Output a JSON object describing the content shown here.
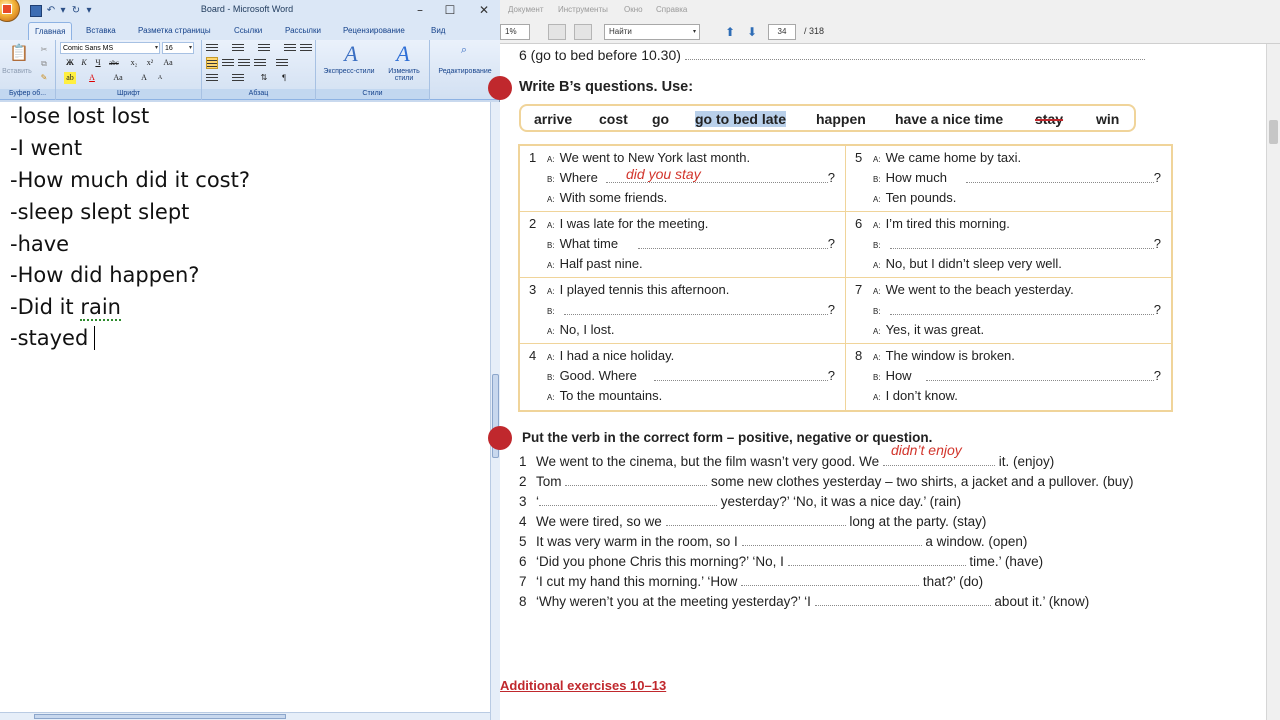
{
  "word": {
    "window_title": "Board - Microsoft Word",
    "tabs": [
      "Главная",
      "Вставка",
      "Разметка страницы",
      "Ссылки",
      "Рассылки",
      "Рецензирование",
      "Вид"
    ],
    "ribbon": {
      "paste_label": "Вставить",
      "clipboard_label": "Буфер об...",
      "font_name": "Comic Sans MS",
      "font_size": "16",
      "font_group_label": "Шрифт",
      "paragraph_group_label": "Абзац",
      "styles_label": "Экспресс-стили",
      "change_styles_label": "Изменить стили",
      "styles_group_label": "Стили",
      "editing_label": "Редактирование"
    },
    "doc_lines": [
      "-lose lost lost",
      "-I went",
      "-How much did it cost?",
      "-sleep slept slept",
      "-have",
      "-How did happen?",
      "-Did it ",
      "rain",
      "-stayed"
    ]
  },
  "pdf": {
    "menu": [
      "Документ",
      "Инструменты",
      "Окно",
      "Справка"
    ],
    "zoom_value": "1%",
    "search_placeholder": "Найти",
    "current_page": "34",
    "total_pages": "/ 318",
    "prev_line": "6   (go to bed before 10.30)",
    "section1_title": "Write B’s questions.  Use:",
    "word_bank": [
      "arrive",
      "cost",
      "go",
      "go to bed late",
      "happen",
      "have a nice time",
      "stay",
      "win"
    ],
    "dialogues": [
      {
        "num": "1",
        "a1": "We went to New York last month.",
        "b": "Where",
        "b_answer": "did you stay",
        "a2": "With some friends."
      },
      {
        "num": "2",
        "a1": "I was late for the meeting.",
        "b": "What time",
        "b_answer": "",
        "a2": "Half past nine."
      },
      {
        "num": "3",
        "a1": "I played tennis this afternoon.",
        "b": "",
        "b_answer": "",
        "a2": "No, I lost."
      },
      {
        "num": "4",
        "a1": "I had a nice holiday.",
        "b": "Good.  Where",
        "b_answer": "",
        "a2": "To the mountains."
      },
      {
        "num": "5",
        "a1": "We came home by taxi.",
        "b": "How much",
        "b_answer": "",
        "a2": "Ten pounds."
      },
      {
        "num": "6",
        "a1": "I’m tired this morning.",
        "b": "",
        "b_answer": "",
        "a2": "No, but I didn’t sleep very well."
      },
      {
        "num": "7",
        "a1": "We went to the beach yesterday.",
        "b": "",
        "b_answer": "",
        "a2": "Yes, it was great."
      },
      {
        "num": "8",
        "a1": "The window is broken.",
        "b": "How",
        "b_answer": "",
        "a2": "I don’t know."
      }
    ],
    "speaker_a": "A:",
    "speaker_b": "B:",
    "q_mark": "?",
    "section2_title": "Put the verb in the correct form – positive, negative or question.",
    "exercises": [
      {
        "n": "1",
        "pre": "We went to the cinema, but the film wasn’t very good.  We",
        "ans": "didn’t enjoy",
        "post": "it.   (enjoy)"
      },
      {
        "n": "2",
        "pre": "Tom",
        "ans": "",
        "post": "some new clothes yesterday – two shirts, a jacket and a pullover.   (buy)"
      },
      {
        "n": "3",
        "pre": "‘",
        "ans": "",
        "post": "yesterday?’   ‘No, it was a nice day.’   (rain)"
      },
      {
        "n": "4",
        "pre": "We were tired, so we",
        "ans": "",
        "post": "long at the party.   (stay)"
      },
      {
        "n": "5",
        "pre": "It was very warm in the room, so I",
        "ans": "",
        "post": "a window.   (open)"
      },
      {
        "n": "6",
        "pre": "‘Did you phone Chris this morning?’    ‘No, I",
        "ans": "",
        "post": "time.’   (have)"
      },
      {
        "n": "7",
        "pre": "‘I cut my hand this morning.’    ‘How",
        "ans": "",
        "post": "that?’   (do)"
      },
      {
        "n": "8",
        "pre": "‘Why weren’t you at the meeting yesterday?’    ‘I",
        "ans": "",
        "post": "about it.’   (know)"
      }
    ],
    "additional_link": "Additional exercises 10–13"
  },
  "colors": {
    "accent_red": "#c0282d",
    "box_border": "#f0d49a",
    "highlight": "#b9d0ea",
    "handwriting": "#d2352c"
  }
}
